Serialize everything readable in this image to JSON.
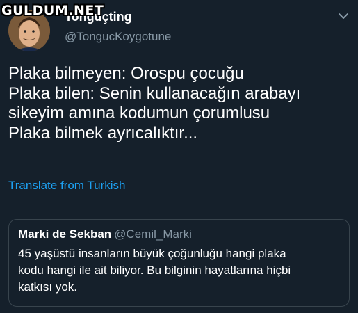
{
  "watermark": "GULDUM.NET",
  "tweet": {
    "display_name": "Tonguçting",
    "handle": "@TongucKoygotune",
    "lines": [
      "Plaka bilmeyen: Orospu çocuğu",
      "Plaka bilen: Senin kullanacağın arabayı",
      "sikeyim amına kodumun çorumlusu",
      "Plaka bilmek ayrıcalıktır..."
    ],
    "translate_label": "Translate from Turkish"
  },
  "quoted_tweet": {
    "display_name": "Marki de Sekban",
    "handle": "@Cemil_Marki",
    "lines": [
      "45 yaşüstü insanların büyük çoğunluğu hangi plaka",
      "kodu hangi ile ait biliyor. Bu bilginin hayatlarına hiçbi",
      "katkısı yok."
    ]
  },
  "colors": {
    "background": "#15202b",
    "link": "#1da1f2",
    "muted": "#8899a6",
    "border": "#38444d"
  },
  "icons": {
    "menu": "chevron-down-icon",
    "avatar": "avatar-photo"
  }
}
